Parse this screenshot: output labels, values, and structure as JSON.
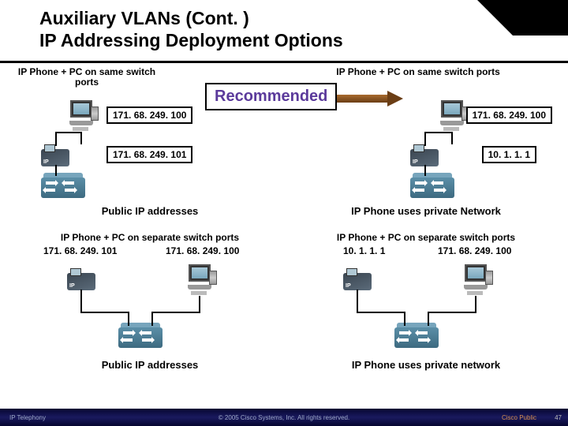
{
  "header": {
    "line1": "Auxiliary VLANs (Cont. )",
    "line2": "IP Addressing Deployment Options"
  },
  "recommended": "Recommended",
  "quads": {
    "tl": {
      "title": "IP Phone + PC on same switch ports",
      "ip_pc": "171. 68. 249. 100",
      "ip_phone": "171. 68. 249. 101",
      "caption": "Public IP addresses"
    },
    "tr": {
      "title": "IP Phone + PC on same switch ports",
      "ip_pc": "171. 68. 249. 100",
      "ip_phone": "10. 1. 1. 1",
      "caption": "IP Phone uses private Network"
    },
    "bl": {
      "title": "IP Phone + PC on separate switch ports",
      "ip_phone": "171. 68. 249. 101",
      "ip_pc": "171. 68. 249. 100",
      "caption": "Public  IP addresses"
    },
    "br": {
      "title": "IP Phone + PC on separate switch ports",
      "ip_phone": "10. 1. 1. 1",
      "ip_pc": "171. 68. 249. 100",
      "caption": "IP Phone uses private network"
    }
  },
  "footer": {
    "left": "IP Telephony",
    "center": "© 2005 Cisco Systems, Inc. All rights reserved.",
    "right": "Cisco Public",
    "page": "47"
  },
  "icons": {
    "phone_badge": "IP"
  }
}
